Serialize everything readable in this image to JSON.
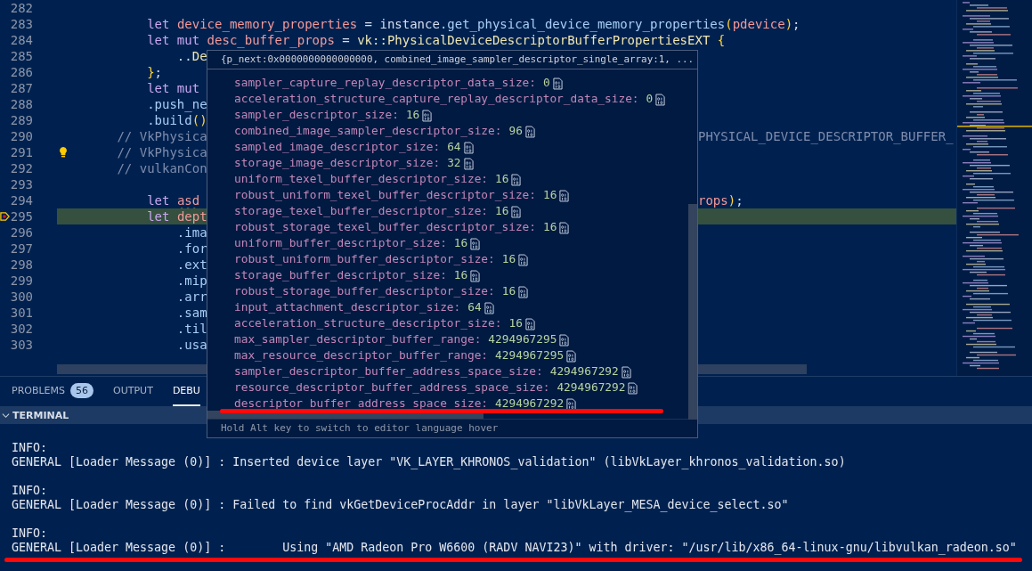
{
  "editor": {
    "lines": [
      {
        "number": "282",
        "current": false,
        "lightbulb": false
      },
      {
        "number": "283",
        "current": false,
        "lightbulb": false,
        "tokens": [
          {
            "text": "            let ",
            "kind": "keyword"
          },
          {
            "text": "device_memory_properties",
            "kind": "var"
          },
          {
            "text": " = ",
            "kind": "plain"
          },
          {
            "text": "instance",
            "kind": "plain"
          },
          {
            "text": ".get_physical_device_memory_properties",
            "kind": "fn"
          },
          {
            "text": "(",
            "kind": "brace"
          },
          {
            "text": "pdevice",
            "kind": "var"
          },
          {
            "text": ")",
            "kind": "brace"
          },
          {
            "text": ";",
            "kind": "plain"
          }
        ]
      },
      {
        "number": "284",
        "current": false,
        "lightbulb": false,
        "tokens": [
          {
            "text": "            let mut ",
            "kind": "keyword"
          },
          {
            "text": "desc_buffer_props",
            "kind": "var"
          },
          {
            "text": " = ",
            "kind": "plain"
          },
          {
            "text": "vk::PhysicalDeviceDescriptorBufferPropertiesEXT ",
            "kind": "type"
          },
          {
            "text": "{",
            "kind": "brace"
          }
        ]
      },
      {
        "number": "285",
        "current": false,
        "lightbulb": false,
        "left": [
          {
            "text": "                ..",
            "kind": "plain"
          },
          {
            "text": "De",
            "kind": "type"
          }
        ]
      },
      {
        "number": "286",
        "current": false,
        "lightbulb": false,
        "left": [
          {
            "text": "            }",
            "kind": "brace"
          },
          {
            "text": ";",
            "kind": "plain"
          }
        ]
      },
      {
        "number": "287",
        "current": false,
        "lightbulb": false,
        "left": [
          {
            "text": "            let mut",
            "kind": "keyword"
          }
        ]
      },
      {
        "number": "288",
        "current": false,
        "lightbulb": false,
        "left": [
          {
            "text": "            .push_ne",
            "kind": "fn"
          }
        ]
      },
      {
        "number": "289",
        "current": false,
        "lightbulb": false,
        "left": [
          {
            "text": "            .build",
            "kind": "fn"
          },
          {
            "text": "()",
            "kind": "brace"
          }
        ]
      },
      {
        "number": "290",
        "current": false,
        "lightbulb": false,
        "left": [
          {
            "text": "        // VkPhysica",
            "kind": "comment"
          }
        ],
        "right": [
          {
            "text": "PHYSICAL_DEVICE_DESCRIPTOR_BUFFER_",
            "kind": "comment"
          }
        ]
      },
      {
        "number": "291",
        "current": false,
        "lightbulb": true,
        "left": [
          {
            "text": "        // VkPhysica",
            "kind": "comment"
          }
        ]
      },
      {
        "number": "292",
        "current": false,
        "lightbulb": false,
        "left": [
          {
            "text": "        // vulkanCon",
            "kind": "comment"
          }
        ]
      },
      {
        "number": "293",
        "current": false,
        "lightbulb": false
      },
      {
        "number": "294",
        "current": false,
        "lightbulb": false,
        "left": [
          {
            "text": "            let ",
            "kind": "keyword"
          },
          {
            "text": "asd",
            "kind": "warn"
          }
        ],
        "right": [
          {
            "text": "rops",
            "kind": "var"
          },
          {
            "text": ")",
            "kind": "brace"
          },
          {
            "text": ";",
            "kind": "plain"
          }
        ]
      },
      {
        "number": "295",
        "current": true,
        "lightbulb": false,
        "left": [
          {
            "text": "            let ",
            "kind": "keyword"
          },
          {
            "text": "dept",
            "kind": "var"
          }
        ]
      },
      {
        "number": "296",
        "current": false,
        "lightbulb": false,
        "left": [
          {
            "text": "                .ima",
            "kind": "fn"
          }
        ]
      },
      {
        "number": "297",
        "current": false,
        "lightbulb": false,
        "left": [
          {
            "text": "                .for",
            "kind": "fn"
          }
        ]
      },
      {
        "number": "298",
        "current": false,
        "lightbulb": false,
        "left": [
          {
            "text": "                .ext",
            "kind": "fn"
          }
        ]
      },
      {
        "number": "299",
        "current": false,
        "lightbulb": false,
        "left": [
          {
            "text": "                .mip",
            "kind": "fn"
          }
        ]
      },
      {
        "number": "300",
        "current": false,
        "lightbulb": false,
        "left": [
          {
            "text": "                .arr",
            "kind": "fn"
          }
        ]
      },
      {
        "number": "301",
        "current": false,
        "lightbulb": false,
        "left": [
          {
            "text": "                .sam",
            "kind": "fn"
          }
        ]
      },
      {
        "number": "302",
        "current": false,
        "lightbulb": false,
        "left": [
          {
            "text": "                .til",
            "kind": "fn"
          }
        ]
      },
      {
        "number": "303",
        "current": false,
        "lightbulb": false,
        "left": [
          {
            "text": "                .usa",
            "kind": "fn"
          }
        ]
      }
    ]
  },
  "hover": {
    "header": "{p_next:0x0000000000000000, combined_image_sampler_descriptor_single_array:1, ...",
    "fields": [
      {
        "name": "sampler_capture_replay_descriptor_data_size:",
        "value": "0"
      },
      {
        "name": "acceleration_structure_capture_replay_descriptor_data_size:",
        "value": "0"
      },
      {
        "name": "sampler_descriptor_size:",
        "value": "16"
      },
      {
        "name": "combined_image_sampler_descriptor_size:",
        "value": "96"
      },
      {
        "name": "sampled_image_descriptor_size:",
        "value": "64"
      },
      {
        "name": "storage_image_descriptor_size:",
        "value": "32"
      },
      {
        "name": "uniform_texel_buffer_descriptor_size:",
        "value": "16"
      },
      {
        "name": "robust_uniform_texel_buffer_descriptor_size:",
        "value": "16"
      },
      {
        "name": "storage_texel_buffer_descriptor_size:",
        "value": "16"
      },
      {
        "name": "robust_storage_texel_buffer_descriptor_size:",
        "value": "16"
      },
      {
        "name": "uniform_buffer_descriptor_size:",
        "value": "16"
      },
      {
        "name": "robust_uniform_buffer_descriptor_size:",
        "value": "16"
      },
      {
        "name": "storage_buffer_descriptor_size:",
        "value": "16"
      },
      {
        "name": "robust_storage_buffer_descriptor_size:",
        "value": "16"
      },
      {
        "name": "input_attachment_descriptor_size:",
        "value": "64"
      },
      {
        "name": "acceleration_structure_descriptor_size:",
        "value": "16"
      },
      {
        "name": "max_sampler_descriptor_buffer_range:",
        "value": "4294967295"
      },
      {
        "name": "max_resource_descriptor_buffer_range:",
        "value": "4294967295"
      },
      {
        "name": "sampler_descriptor_buffer_address_space_size:",
        "value": "4294967292"
      },
      {
        "name": "resource_descriptor_buffer_address_space_size:",
        "value": "4294967292"
      },
      {
        "name": "descriptor_buffer_address_space_size:",
        "value": "4294967292"
      }
    ],
    "footer": "Hold Alt key to switch to editor language hover"
  },
  "panel": {
    "tabs": [
      {
        "label": "PROBLEMS",
        "badge": "56",
        "selected": false
      },
      {
        "label": "OUTPUT",
        "selected": false
      },
      {
        "label": "DEBU",
        "selected": true
      }
    ],
    "terminal": {
      "title": "TERMINAL",
      "expanded": true,
      "messages": [
        {
          "level": "INFO:",
          "text": "GENERAL [Loader Message (0)] : Inserted device layer \"VK_LAYER_KHRONOS_validation\" (libVkLayer_khronos_validation.so)"
        },
        {
          "level": "INFO:",
          "text": "GENERAL [Loader Message (0)] : Failed to find vkGetDeviceProcAddr in layer \"libVkLayer_MESA_device_select.so\""
        },
        {
          "level": "INFO:",
          "text": "GENERAL [Loader Message (0)] :        Using \"AMD Radeon Pro W6600 (RADV NAVI23)\" with driver: \"/usr/lib/x86_64-linux-gnu/libvulkan_radeon.so\""
        }
      ]
    }
  }
}
